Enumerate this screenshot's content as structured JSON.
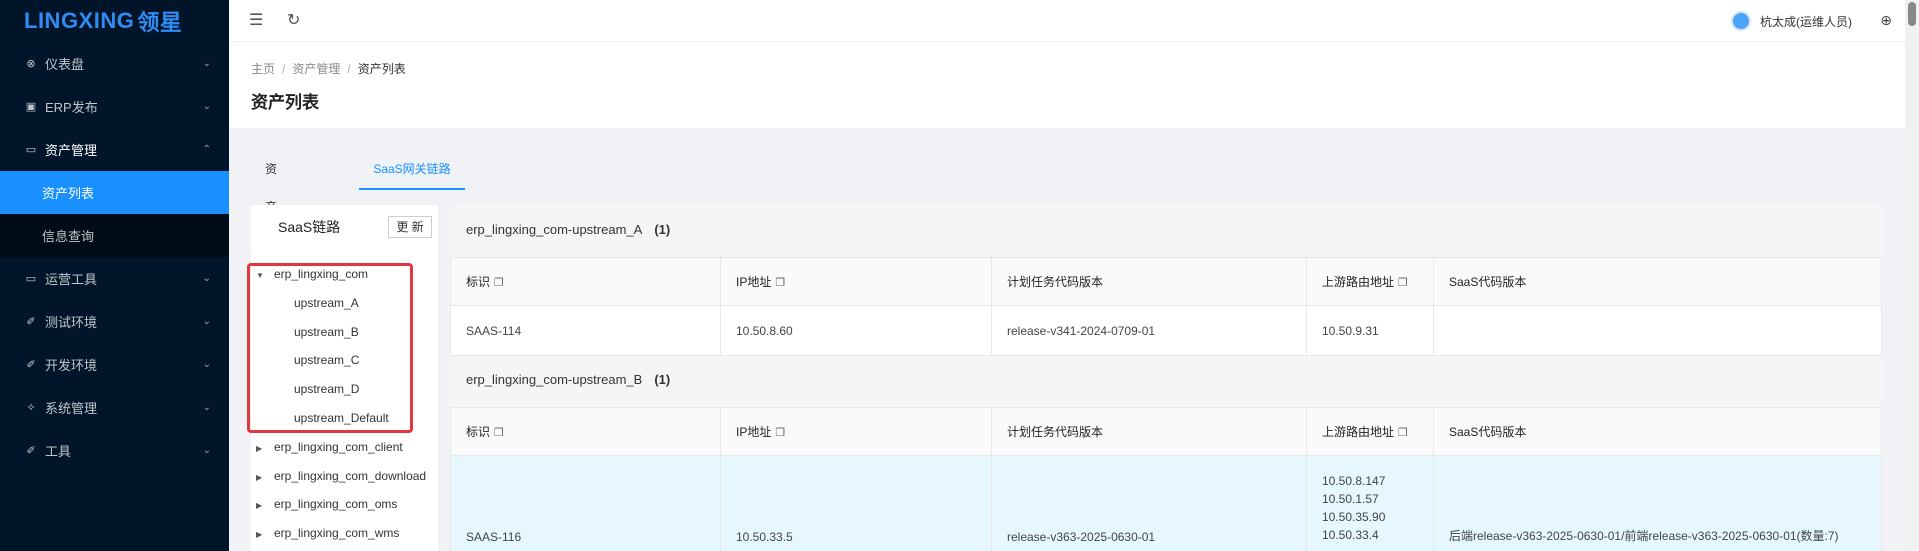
{
  "app": {
    "logo_text": "LINGXING",
    "logo_cn": "领星"
  },
  "sidebar": {
    "items": [
      {
        "label": "仪表盘",
        "icon": "dashboard-icon"
      },
      {
        "label": "ERP发布",
        "icon": "publish-icon"
      },
      {
        "label": "资产管理",
        "icon": "asset-icon",
        "expanded": true
      },
      {
        "label": "运营工具",
        "icon": "tool-icon"
      },
      {
        "label": "测试环境",
        "icon": "test-icon"
      },
      {
        "label": "开发环境",
        "icon": "dev-icon"
      },
      {
        "label": "系统管理",
        "icon": "system-icon"
      },
      {
        "label": "工具",
        "icon": "wrench-icon"
      }
    ],
    "sub_items": [
      {
        "label": "资产列表",
        "active": true
      },
      {
        "label": "信息查询"
      }
    ]
  },
  "header": {
    "user_name": "杭太成(运维人员)"
  },
  "breadcrumb": [
    "主页",
    "资产管理",
    "资产列表"
  ],
  "page_title": "资产列表",
  "tabs": [
    {
      "label": "资产信息"
    },
    {
      "label": "SaaS网关链路",
      "active": true
    }
  ],
  "tree": {
    "title": "SaaS链路",
    "refresh_label": "更 新",
    "nodes": [
      {
        "label": "erp_lingxing_com",
        "expanded": true
      },
      {
        "label": "upstream_A"
      },
      {
        "label": "upstream_B"
      },
      {
        "label": "upstream_C"
      },
      {
        "label": "upstream_D"
      },
      {
        "label": "upstream_Default"
      },
      {
        "label": "erp_lingxing_com_client"
      },
      {
        "label": "erp_lingxing_com_download"
      },
      {
        "label": "erp_lingxing_com_oms"
      },
      {
        "label": "erp_lingxing_com_wms"
      }
    ]
  },
  "table_columns": [
    "标识",
    "IP地址",
    "计划任务代码版本",
    "上游路由地址",
    "SaaS代码版本"
  ],
  "groups": [
    {
      "name": "erp_lingxing_com-upstream_A",
      "count": "(1)",
      "rows": [
        {
          "id": "SAAS-114",
          "ip": "10.50.8.60",
          "cron_version": "release-v341-2024-0709-01",
          "upstream": [
            "10.50.9.31"
          ],
          "saas_version": ""
        }
      ]
    },
    {
      "name": "erp_lingxing_com-upstream_B",
      "count": "(1)",
      "rows": [
        {
          "id": "SAAS-116",
          "ip": "10.50.33.5",
          "cron_version": "release-v363-2025-0630-01",
          "upstream": [
            "10.50.8.147",
            "10.50.1.57",
            "10.50.35.90",
            "10.50.33.4"
          ],
          "saas_version": "后端release-v363-2025-0630-01/前端release-v363-2025-0630-01(数量:7)"
        }
      ]
    }
  ]
}
